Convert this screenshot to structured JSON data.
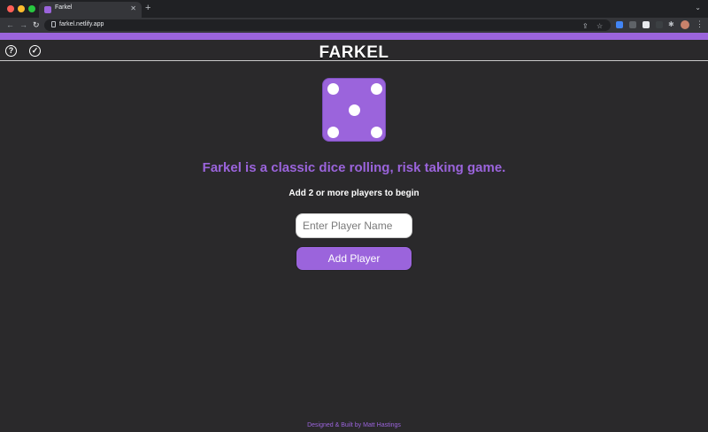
{
  "browser": {
    "tab_title": "Farkel",
    "tab_close": "✕",
    "new_tab": "+",
    "chevron": "⌄",
    "url": "farkel.netlify.app",
    "menu": "⋮"
  },
  "header": {
    "title": "FARKEL",
    "help_glyph": "?",
    "check_glyph": "✓"
  },
  "main": {
    "die_face": 5,
    "tagline": "Farkel is a classic dice rolling, risk taking game.",
    "instruction": "Add 2 or more players to begin",
    "player_input": {
      "placeholder": "Enter Player Name",
      "value": ""
    },
    "add_player_label": "Add Player"
  },
  "footer": {
    "credit": "Designed & Built by Matt Hastings"
  },
  "colors": {
    "accent": "#9b64dc",
    "background": "#2a292b"
  }
}
